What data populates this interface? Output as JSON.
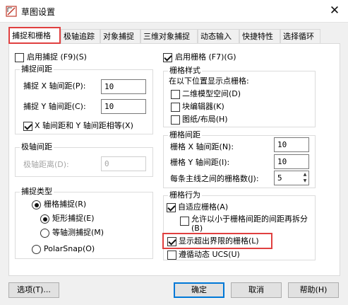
{
  "window": {
    "title": "草图设置",
    "close_glyph": "✕",
    "icon": "drafting-settings-icon"
  },
  "tabs": [
    {
      "label": "捕捉和栅格",
      "active": true
    },
    {
      "label": "极轴追踪"
    },
    {
      "label": "对象捕捉"
    },
    {
      "label": "三维对象捕捉"
    },
    {
      "label": "动态输入"
    },
    {
      "label": "快捷特性"
    },
    {
      "label": "选择循环"
    }
  ],
  "snap": {
    "enable_label": "启用捕捉 (F9)(S)",
    "enable_checked": false,
    "spacing": {
      "legend": "捕捉间距",
      "x_label": "捕捉 X 轴间距(P):",
      "x_value": "10",
      "y_label": "捕捉 Y 轴间距(C):",
      "y_value": "10",
      "equal_label": "X 轴间距和 Y 轴间距相等(X)",
      "equal_checked": true
    },
    "polar": {
      "legend": "极轴间距",
      "distance_label": "极轴距离(D):",
      "distance_value": "0"
    },
    "type": {
      "legend": "捕捉类型",
      "grid_snap_label": "栅格捕捉(R)",
      "rect_snap_label": "矩形捕捉(E)",
      "iso_snap_label": "等轴测捕捉(M)",
      "polar_snap_label": "PolarSnap(O)",
      "selected": "grid_snap",
      "grid_sub_selected": "rect_snap"
    }
  },
  "grid": {
    "enable_label": "启用栅格 (F7)(G)",
    "enable_checked": true,
    "style": {
      "legend": "栅格样式",
      "description": "在以下位置显示点栅格:",
      "model_space_label": "二维模型空间(D)",
      "block_editor_label": "块编辑器(K)",
      "sheet_layout_label": "图纸/布局(H)"
    },
    "spacing": {
      "legend": "栅格间距",
      "x_label": "栅格 X 轴间距(N):",
      "x_value": "10",
      "y_label": "栅格 Y 轴间距(I):",
      "y_value": "10",
      "major_label": "每条主线之间的栅格数(J):",
      "major_value": "5"
    },
    "behavior": {
      "legend": "栅格行为",
      "adaptive_label": "自适应栅格(A)",
      "adaptive_checked": true,
      "subdivide_label": "允许以小于栅格间距的间距再拆分(B)",
      "subdivide_checked": false,
      "beyond_limits_label": "显示超出界限的栅格(L)",
      "beyond_limits_checked": true,
      "follow_ucs_label": "遵循动态 UCS(U)",
      "follow_ucs_checked": false
    }
  },
  "buttons": {
    "options": "选项(T)...",
    "ok": "确定",
    "cancel": "取消",
    "help": "帮助(H)"
  },
  "colors": {
    "highlight": "#e04040",
    "default_button": "#0078d7"
  }
}
